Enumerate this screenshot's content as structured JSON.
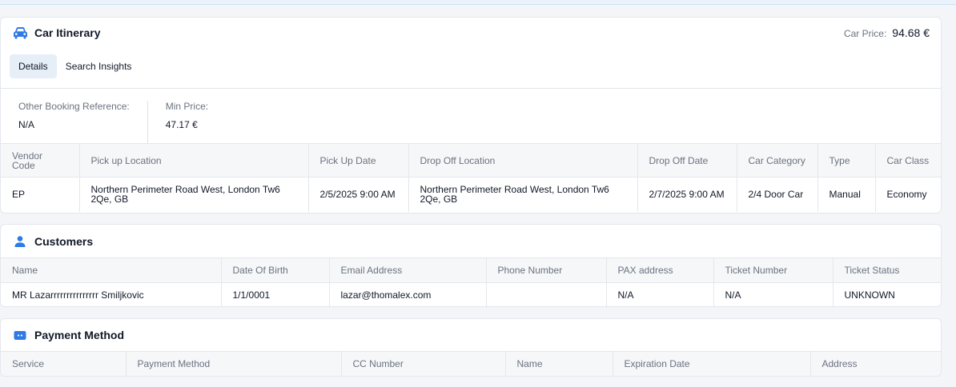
{
  "car_itinerary": {
    "title": "Car Itinerary",
    "icon": "car-icon",
    "price_label": "Car Price:",
    "price_value": "94.68 €",
    "tabs": [
      {
        "label": "Details",
        "active": true
      },
      {
        "label": "Search Insights",
        "active": false
      }
    ],
    "info": [
      {
        "label": "Other Booking Reference:",
        "value": "N/A"
      },
      {
        "label": "Min Price:",
        "value": "47.17 €"
      }
    ],
    "table": {
      "columns": [
        "Vendor Code",
        "Pick up Location",
        "Pick Up Date",
        "Drop Off Location",
        "Drop Off Date",
        "Car Category",
        "Type",
        "Car Class"
      ],
      "rows": [
        [
          "EP",
          "Northern Perimeter Road West, London Tw6 2Qe, GB",
          "2/5/2025 9:00 AM",
          "Northern Perimeter Road West, London Tw6 2Qe, GB",
          "2/7/2025 9:00 AM",
          "2/4 Door Car",
          "Manual",
          "Economy"
        ]
      ]
    }
  },
  "customers": {
    "title": "Customers",
    "icon": "user-icon",
    "table": {
      "columns": [
        "Name",
        "Date Of Birth",
        "Email Address",
        "Phone Number",
        "PAX address",
        "Ticket Number",
        "Ticket Status"
      ],
      "rows": [
        [
          "MR Lazarrrrrrrrrrrrrrr Smiljkovic",
          "1/1/0001",
          "lazar@thomalex.com",
          "",
          "N/A",
          "N/A",
          "UNKNOWN"
        ]
      ]
    }
  },
  "payment_method": {
    "title": "Payment Method",
    "icon": "credit-card-icon",
    "table": {
      "columns": [
        "Service",
        "Payment Method",
        "CC Number",
        "Name",
        "Expiration Date",
        "Address"
      ]
    }
  },
  "colors": {
    "accent": "#2f7be5",
    "tab_active_bg": "#e6eef8"
  }
}
